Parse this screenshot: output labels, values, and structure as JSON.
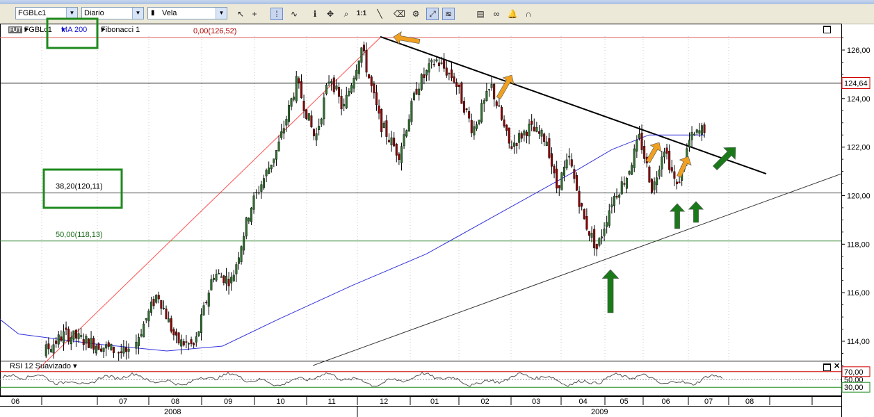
{
  "toolbar": {
    "symbol": "FGBLc1",
    "interval": "Diario",
    "chart_type": "Vela",
    "zoom_label": "1:1",
    "icons": [
      "cursor-icon",
      "crosshair-icon",
      "grid-icon",
      "indicator-icon",
      "info-icon",
      "pan-icon",
      "zoom-icon",
      "line-icon",
      "eraser-icon",
      "format-icon",
      "trend-tool-icon",
      "fib-tool-icon",
      "properties-icon",
      "link-icon",
      "alert-icon",
      "magnet-icon"
    ]
  },
  "header": {
    "symbol": "FGBLc1",
    "ma": "MA 200",
    "fib": "Fibonacci 1"
  },
  "rsi_header": "RSI 12 Suavizado",
  "colors": {
    "up_candle": "#2f6f2f",
    "down_candle": "#8b0000",
    "ma_line": "#3333dd",
    "fib_line": "#e06060",
    "annotation_box": "#1e8a1e",
    "arrow_orange": "#f0a020",
    "arrow_green": "#1a7a1a"
  },
  "chart_data": {
    "type": "candlestick",
    "ylim": [
      112.8,
      127.0
    ],
    "yticks": [
      "126,00",
      "124,00",
      "122,00",
      "120,00",
      "118,00",
      "116,00",
      "114,00"
    ],
    "price_marker": "124,64",
    "fib_levels": [
      {
        "label": "0,00(126,52)",
        "value": 126.52
      },
      {
        "label": "38,20(120,11)",
        "value": 120.11
      },
      {
        "label": "50,00(118,13)",
        "value": 118.13
      }
    ],
    "month_labels": [
      "06",
      "07",
      "08",
      "09",
      "10",
      "11",
      "12",
      "01",
      "02",
      "03",
      "04",
      "05",
      "06",
      "07",
      "08"
    ],
    "year_labels": [
      "2008",
      "2009"
    ],
    "rsi_levels": [
      "70,00",
      "50,00",
      "30,00"
    ],
    "close_path": [
      {
        "d": 0,
        "v": 112.7
      },
      {
        "d": 25,
        "v": 114.3
      },
      {
        "d": 45,
        "v": 113.8
      },
      {
        "d": 60,
        "v": 113.4
      },
      {
        "d": 75,
        "v": 116.0
      },
      {
        "d": 85,
        "v": 114.0
      },
      {
        "d": 95,
        "v": 113.8
      },
      {
        "d": 105,
        "v": 116.8
      },
      {
        "d": 115,
        "v": 116.5
      },
      {
        "d": 125,
        "v": 119.5
      },
      {
        "d": 140,
        "v": 122.0
      },
      {
        "d": 150,
        "v": 124.7
      },
      {
        "d": 160,
        "v": 122.3
      },
      {
        "d": 168,
        "v": 125.0
      },
      {
        "d": 175,
        "v": 123.5
      },
      {
        "d": 185,
        "v": 126.1
      },
      {
        "d": 195,
        "v": 123.0
      },
      {
        "d": 205,
        "v": 121.7
      },
      {
        "d": 215,
        "v": 124.5
      },
      {
        "d": 225,
        "v": 125.6
      },
      {
        "d": 235,
        "v": 124.8
      },
      {
        "d": 245,
        "v": 122.7
      },
      {
        "d": 255,
        "v": 124.5
      },
      {
        "d": 265,
        "v": 122.0
      },
      {
        "d": 275,
        "v": 122.8
      },
      {
        "d": 285,
        "v": 122.3
      },
      {
        "d": 290,
        "v": 120.3
      },
      {
        "d": 297,
        "v": 121.5
      },
      {
        "d": 305,
        "v": 119.0
      },
      {
        "d": 312,
        "v": 117.8
      },
      {
        "d": 320,
        "v": 119.8
      },
      {
        "d": 328,
        "v": 120.8
      },
      {
        "d": 335,
        "v": 122.4
      },
      {
        "d": 342,
        "v": 120.2
      },
      {
        "d": 348,
        "v": 122.1
      },
      {
        "d": 355,
        "v": 120.3
      },
      {
        "d": 362,
        "v": 122.3
      },
      {
        "d": 370,
        "v": 122.8
      }
    ],
    "ma200_path": [
      {
        "d": -50,
        "v": 114.9
      },
      {
        "d": 0,
        "v": 114.3
      },
      {
        "d": 40,
        "v": 113.9
      },
      {
        "d": 80,
        "v": 113.6
      },
      {
        "d": 110,
        "v": 113.8
      },
      {
        "d": 140,
        "v": 114.9
      },
      {
        "d": 180,
        "v": 116.3
      },
      {
        "d": 220,
        "v": 117.6
      },
      {
        "d": 260,
        "v": 119.3
      },
      {
        "d": 300,
        "v": 121.0
      },
      {
        "d": 320,
        "v": 121.9
      },
      {
        "d": 340,
        "v": 122.5
      },
      {
        "d": 370,
        "v": 122.5
      }
    ]
  }
}
